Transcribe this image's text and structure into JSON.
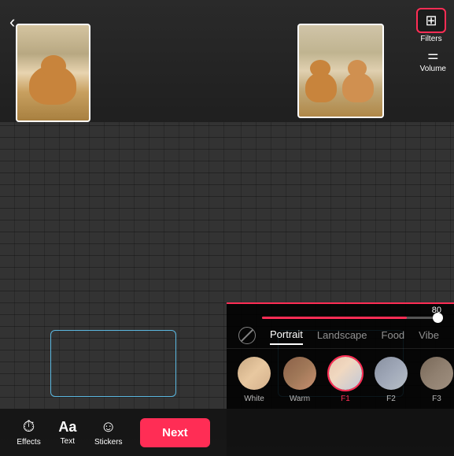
{
  "left": {
    "back_arrow": "‹",
    "toolbar": {
      "effects_label": "Effects",
      "text_label": "Text",
      "stickers_label": "Stickers",
      "next_label": "Next"
    }
  },
  "right": {
    "filters_label": "Filters",
    "volume_label": "Volume",
    "slider_value": "80",
    "filter_tabs": [
      {
        "id": "portrait",
        "label": "Portrait",
        "active": true
      },
      {
        "id": "landscape",
        "label": "Landscape",
        "active": false
      },
      {
        "id": "food",
        "label": "Food",
        "active": false
      },
      {
        "id": "vibe",
        "label": "Vibe",
        "active": false
      }
    ],
    "filter_items": [
      {
        "id": "white",
        "label": "White",
        "selected": false,
        "face_class": "face-white"
      },
      {
        "id": "warm",
        "label": "Warm",
        "selected": false,
        "face_class": "face-warm"
      },
      {
        "id": "f1",
        "label": "F1",
        "selected": true,
        "face_class": "face-f1"
      },
      {
        "id": "f2",
        "label": "F2",
        "selected": false,
        "face_class": "face-f2"
      },
      {
        "id": "f3",
        "label": "F3",
        "selected": false,
        "face_class": "face-f3"
      }
    ]
  }
}
